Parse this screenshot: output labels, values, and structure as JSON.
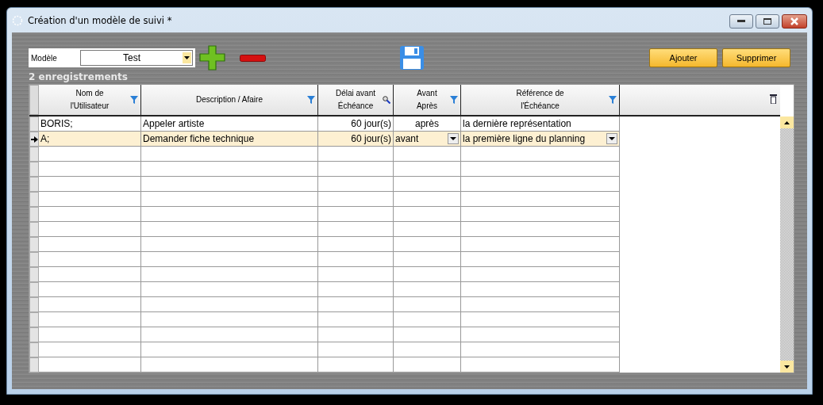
{
  "window": {
    "title": "Création d'un modèle de suivi *"
  },
  "toolbar": {
    "model_label": "Modèle",
    "model_value": "Test",
    "buttons": [
      "Ajouter",
      "Supprimer"
    ]
  },
  "record_count": "2 enregistrements",
  "table": {
    "columns": [
      {
        "label": [
          "Nom de",
          "l'Utilisateur"
        ],
        "kind": "filter"
      },
      {
        "label": [
          "Description / Afaire"
        ],
        "kind": "filter"
      },
      {
        "label": [
          "Délai avant",
          "Échéance"
        ],
        "kind": "search"
      },
      {
        "label": [
          "Avant",
          "Après"
        ],
        "kind": "filter"
      },
      {
        "label": [
          "Référence de",
          "l'Échéance"
        ],
        "kind": "filter"
      }
    ],
    "rows": [
      {
        "selected": false,
        "cells": [
          "BORIS;",
          "Appeler artiste",
          "60 jour(s)",
          "après",
          "la dernière représentation"
        ]
      },
      {
        "selected": true,
        "cells": [
          "A;",
          "Demander fiche technique",
          "60 jour(s)",
          "avant",
          "la première ligne du planning"
        ]
      }
    ]
  }
}
